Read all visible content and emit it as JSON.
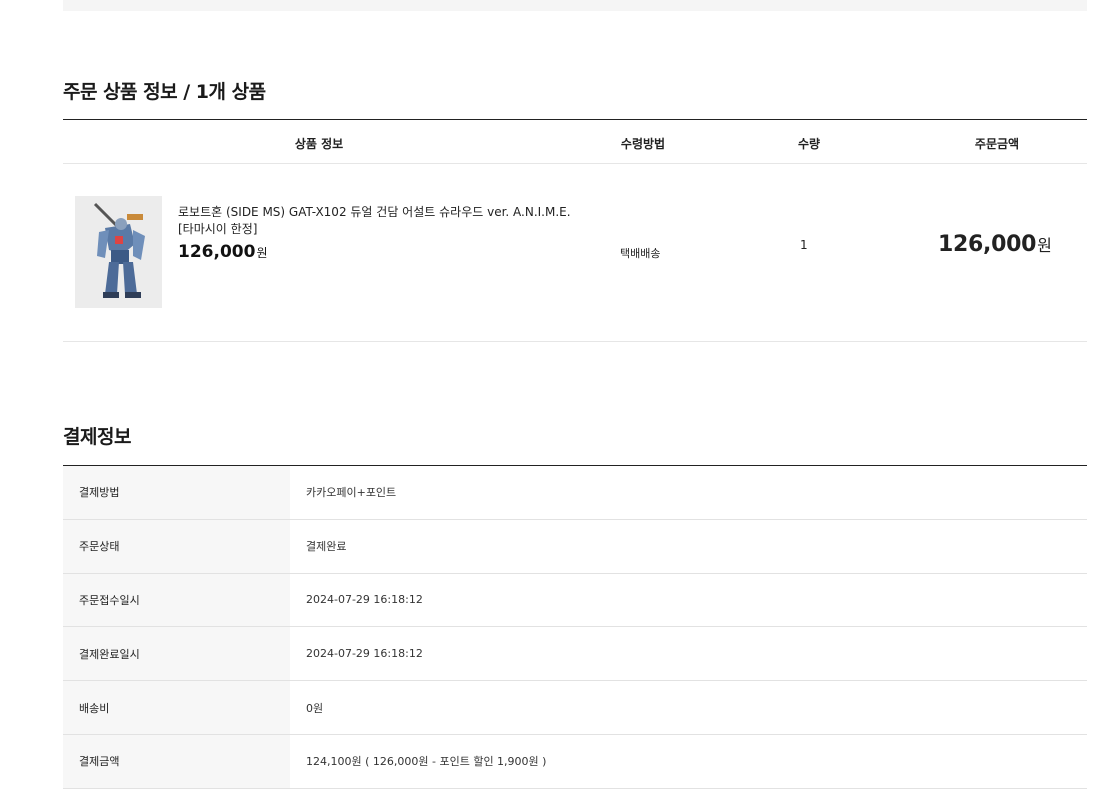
{
  "order_section": {
    "title": "주문 상품 정보 / 1개 상품",
    "headers": {
      "info": "상품 정보",
      "method": "수령방법",
      "qty": "수량",
      "amount": "주문금액"
    },
    "item": {
      "image_icon": "robot-figure-image",
      "name": "로보트혼 (SIDE MS) GAT-X102 듀얼 건담 어설트 슈라우드 ver. A.N.I.M.E. [타마시이 한정]",
      "price": "126,000",
      "currency": "원",
      "delivery_method": "택배배송",
      "quantity": "1",
      "amount": "126,000"
    }
  },
  "payment_section": {
    "title": "결제정보",
    "rows": [
      {
        "label": "결제방법",
        "value": "카카오페이+포인트"
      },
      {
        "label": "주문상태",
        "value": "결제완료"
      },
      {
        "label": "주문접수일시",
        "value": "2024-07-29 16:18:12"
      },
      {
        "label": "결제완료일시",
        "value": "2024-07-29 16:18:12"
      },
      {
        "label": "배송비",
        "value": "0원"
      },
      {
        "label": "결제금액",
        "value": "124,100원 ( 126,000원 - 포인트 할인 1,900원 )"
      }
    ]
  }
}
